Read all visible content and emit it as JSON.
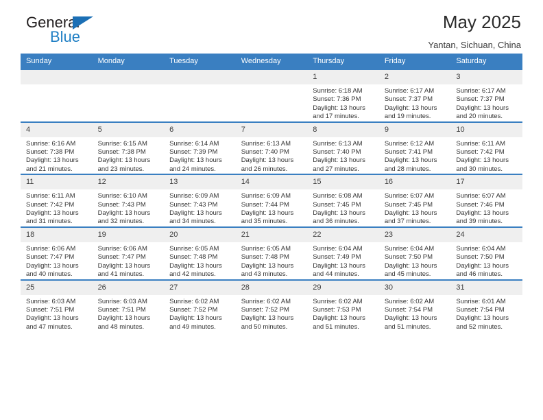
{
  "brand": {
    "name_top": "General",
    "name_bottom": "Blue"
  },
  "header": {
    "title": "May 2025",
    "location": "Yantan, Sichuan, China"
  },
  "colors": {
    "header_blue": "#3a7fc1",
    "brand_blue": "#1f7fc4",
    "daynum_band": "#efefef",
    "text": "#333333"
  },
  "weekday_headers": [
    "Sunday",
    "Monday",
    "Tuesday",
    "Wednesday",
    "Thursday",
    "Friday",
    "Saturday"
  ],
  "labels": {
    "sunrise_prefix": "Sunrise:",
    "sunset_prefix": "Sunset:",
    "daylight_prefix": "Daylight:"
  },
  "weeks": [
    [
      {
        "day": "",
        "empty": true
      },
      {
        "day": "",
        "empty": true
      },
      {
        "day": "",
        "empty": true
      },
      {
        "day": "",
        "empty": true
      },
      {
        "day": "1",
        "sunrise": "Sunrise: 6:18 AM",
        "sunset": "Sunset: 7:36 PM",
        "daylight_line1": "Daylight: 13 hours",
        "daylight_line2": "and 17 minutes."
      },
      {
        "day": "2",
        "sunrise": "Sunrise: 6:17 AM",
        "sunset": "Sunset: 7:37 PM",
        "daylight_line1": "Daylight: 13 hours",
        "daylight_line2": "and 19 minutes."
      },
      {
        "day": "3",
        "sunrise": "Sunrise: 6:17 AM",
        "sunset": "Sunset: 7:37 PM",
        "daylight_line1": "Daylight: 13 hours",
        "daylight_line2": "and 20 minutes."
      }
    ],
    [
      {
        "day": "4",
        "sunrise": "Sunrise: 6:16 AM",
        "sunset": "Sunset: 7:38 PM",
        "daylight_line1": "Daylight: 13 hours",
        "daylight_line2": "and 21 minutes."
      },
      {
        "day": "5",
        "sunrise": "Sunrise: 6:15 AM",
        "sunset": "Sunset: 7:38 PM",
        "daylight_line1": "Daylight: 13 hours",
        "daylight_line2": "and 23 minutes."
      },
      {
        "day": "6",
        "sunrise": "Sunrise: 6:14 AM",
        "sunset": "Sunset: 7:39 PM",
        "daylight_line1": "Daylight: 13 hours",
        "daylight_line2": "and 24 minutes."
      },
      {
        "day": "7",
        "sunrise": "Sunrise: 6:13 AM",
        "sunset": "Sunset: 7:40 PM",
        "daylight_line1": "Daylight: 13 hours",
        "daylight_line2": "and 26 minutes."
      },
      {
        "day": "8",
        "sunrise": "Sunrise: 6:13 AM",
        "sunset": "Sunset: 7:40 PM",
        "daylight_line1": "Daylight: 13 hours",
        "daylight_line2": "and 27 minutes."
      },
      {
        "day": "9",
        "sunrise": "Sunrise: 6:12 AM",
        "sunset": "Sunset: 7:41 PM",
        "daylight_line1": "Daylight: 13 hours",
        "daylight_line2": "and 28 minutes."
      },
      {
        "day": "10",
        "sunrise": "Sunrise: 6:11 AM",
        "sunset": "Sunset: 7:42 PM",
        "daylight_line1": "Daylight: 13 hours",
        "daylight_line2": "and 30 minutes."
      }
    ],
    [
      {
        "day": "11",
        "sunrise": "Sunrise: 6:11 AM",
        "sunset": "Sunset: 7:42 PM",
        "daylight_line1": "Daylight: 13 hours",
        "daylight_line2": "and 31 minutes."
      },
      {
        "day": "12",
        "sunrise": "Sunrise: 6:10 AM",
        "sunset": "Sunset: 7:43 PM",
        "daylight_line1": "Daylight: 13 hours",
        "daylight_line2": "and 32 minutes."
      },
      {
        "day": "13",
        "sunrise": "Sunrise: 6:09 AM",
        "sunset": "Sunset: 7:43 PM",
        "daylight_line1": "Daylight: 13 hours",
        "daylight_line2": "and 34 minutes."
      },
      {
        "day": "14",
        "sunrise": "Sunrise: 6:09 AM",
        "sunset": "Sunset: 7:44 PM",
        "daylight_line1": "Daylight: 13 hours",
        "daylight_line2": "and 35 minutes."
      },
      {
        "day": "15",
        "sunrise": "Sunrise: 6:08 AM",
        "sunset": "Sunset: 7:45 PM",
        "daylight_line1": "Daylight: 13 hours",
        "daylight_line2": "and 36 minutes."
      },
      {
        "day": "16",
        "sunrise": "Sunrise: 6:07 AM",
        "sunset": "Sunset: 7:45 PM",
        "daylight_line1": "Daylight: 13 hours",
        "daylight_line2": "and 37 minutes."
      },
      {
        "day": "17",
        "sunrise": "Sunrise: 6:07 AM",
        "sunset": "Sunset: 7:46 PM",
        "daylight_line1": "Daylight: 13 hours",
        "daylight_line2": "and 39 minutes."
      }
    ],
    [
      {
        "day": "18",
        "sunrise": "Sunrise: 6:06 AM",
        "sunset": "Sunset: 7:47 PM",
        "daylight_line1": "Daylight: 13 hours",
        "daylight_line2": "and 40 minutes."
      },
      {
        "day": "19",
        "sunrise": "Sunrise: 6:06 AM",
        "sunset": "Sunset: 7:47 PM",
        "daylight_line1": "Daylight: 13 hours",
        "daylight_line2": "and 41 minutes."
      },
      {
        "day": "20",
        "sunrise": "Sunrise: 6:05 AM",
        "sunset": "Sunset: 7:48 PM",
        "daylight_line1": "Daylight: 13 hours",
        "daylight_line2": "and 42 minutes."
      },
      {
        "day": "21",
        "sunrise": "Sunrise: 6:05 AM",
        "sunset": "Sunset: 7:48 PM",
        "daylight_line1": "Daylight: 13 hours",
        "daylight_line2": "and 43 minutes."
      },
      {
        "day": "22",
        "sunrise": "Sunrise: 6:04 AM",
        "sunset": "Sunset: 7:49 PM",
        "daylight_line1": "Daylight: 13 hours",
        "daylight_line2": "and 44 minutes."
      },
      {
        "day": "23",
        "sunrise": "Sunrise: 6:04 AM",
        "sunset": "Sunset: 7:50 PM",
        "daylight_line1": "Daylight: 13 hours",
        "daylight_line2": "and 45 minutes."
      },
      {
        "day": "24",
        "sunrise": "Sunrise: 6:04 AM",
        "sunset": "Sunset: 7:50 PM",
        "daylight_line1": "Daylight: 13 hours",
        "daylight_line2": "and 46 minutes."
      }
    ],
    [
      {
        "day": "25",
        "sunrise": "Sunrise: 6:03 AM",
        "sunset": "Sunset: 7:51 PM",
        "daylight_line1": "Daylight: 13 hours",
        "daylight_line2": "and 47 minutes."
      },
      {
        "day": "26",
        "sunrise": "Sunrise: 6:03 AM",
        "sunset": "Sunset: 7:51 PM",
        "daylight_line1": "Daylight: 13 hours",
        "daylight_line2": "and 48 minutes."
      },
      {
        "day": "27",
        "sunrise": "Sunrise: 6:02 AM",
        "sunset": "Sunset: 7:52 PM",
        "daylight_line1": "Daylight: 13 hours",
        "daylight_line2": "and 49 minutes."
      },
      {
        "day": "28",
        "sunrise": "Sunrise: 6:02 AM",
        "sunset": "Sunset: 7:52 PM",
        "daylight_line1": "Daylight: 13 hours",
        "daylight_line2": "and 50 minutes."
      },
      {
        "day": "29",
        "sunrise": "Sunrise: 6:02 AM",
        "sunset": "Sunset: 7:53 PM",
        "daylight_line1": "Daylight: 13 hours",
        "daylight_line2": "and 51 minutes."
      },
      {
        "day": "30",
        "sunrise": "Sunrise: 6:02 AM",
        "sunset": "Sunset: 7:54 PM",
        "daylight_line1": "Daylight: 13 hours",
        "daylight_line2": "and 51 minutes."
      },
      {
        "day": "31",
        "sunrise": "Sunrise: 6:01 AM",
        "sunset": "Sunset: 7:54 PM",
        "daylight_line1": "Daylight: 13 hours",
        "daylight_line2": "and 52 minutes."
      }
    ]
  ]
}
